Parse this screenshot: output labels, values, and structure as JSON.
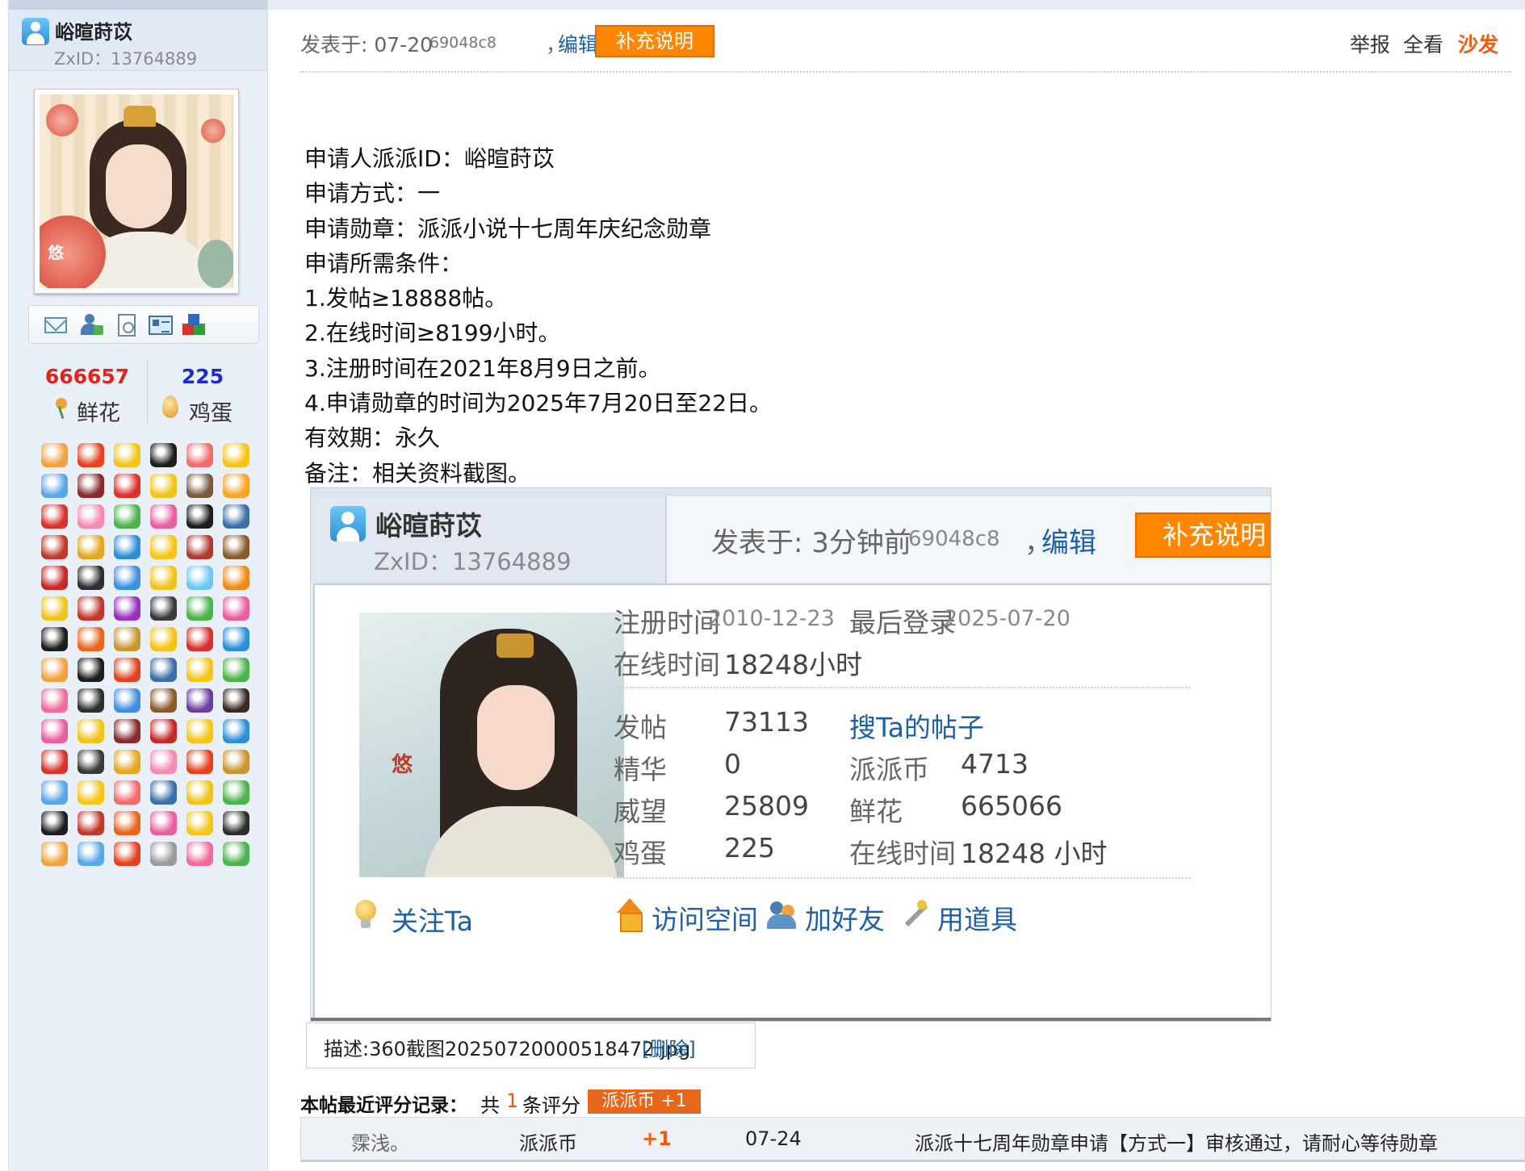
{
  "colors": {
    "accent_orange": "#ff8600",
    "link_blue": "#1d5fa8",
    "flower_red": "#e4211a",
    "egg_blue": "#1a2bd0",
    "sofa_orange": "#f05a12",
    "sidebar_bg": "#e9f0f8"
  },
  "sidebar": {
    "username": "峪暄莳苡",
    "zxid": "ZxID：13764889",
    "avatar_mark": "悠",
    "stats": {
      "flowers": "666657",
      "flowers_label": "鲜花",
      "eggs": "225",
      "eggs_label": "鸡蛋"
    },
    "medal_colors": [
      "#f2a23b",
      "#e4411f",
      "#f5c518",
      "#1d1d1d",
      "#f26b6b",
      "#f5c518",
      "#5aa7e8",
      "#8a2a2a",
      "#d9312b",
      "#f0c419",
      "#7a5a3a",
      "#f5a623",
      "#d9312b",
      "#f58bb3",
      "#4db34d",
      "#e85fa0",
      "#1d1d1d",
      "#3c6fa8",
      "#c0392b",
      "#e3a820",
      "#2d8fd6",
      "#f5c518",
      "#b03a2e",
      "#8a5a2b",
      "#c62828",
      "#2e2e2e",
      "#3d8fe0",
      "#f0c419",
      "#6ec6f5",
      "#f08a16",
      "#f0c419",
      "#c0392b",
      "#9b2fbf",
      "#3a3a3a",
      "#4db34d",
      "#e85fa0",
      "#1d1d1d",
      "#e8651c",
      "#c9952f",
      "#f5c518",
      "#d9312b",
      "#2d8fd6",
      "#f2a23b",
      "#1d1d1d",
      "#e4411f",
      "#3c6fa8",
      "#f5c518",
      "#4db34d",
      "#f26b9b",
      "#2e2e2e",
      "#3d8fe0",
      "#8a5a2b",
      "#6b3fa0",
      "#3a2a22",
      "#e85fa0",
      "#f0c419",
      "#8a2a2a",
      "#c62828",
      "#f5c518",
      "#2d8fd6",
      "#d9312b",
      "#3a3a3a",
      "#e3a820",
      "#f58bb3",
      "#e4411f",
      "#c9952f",
      "#5aa7e8",
      "#f5c518",
      "#f26b6b",
      "#3c6fa8",
      "#f0c419",
      "#4db34d",
      "#1d1d1d",
      "#c0392b",
      "#e8651c",
      "#e85fa0",
      "#f5c518",
      "#2e2e2e",
      "#f2a23b",
      "#5aa7e8",
      "#e4411f",
      "#9b9b9b",
      "#f26b9b",
      "#4db34d"
    ]
  },
  "post": {
    "posted_label": "发表于: 07-20",
    "hash": "69048c8",
    "comma": "，",
    "edit_label": "编辑",
    "supplement_label": "补充说明",
    "report_label": "举报",
    "view_all_label": "全看",
    "sofa_label": "沙发",
    "lines": [
      "申请人派派ID：峪暄莳苡",
      "申请方式：一",
      "申请勋章：派派小说十七周年庆纪念勋章",
      "申请所需条件：",
      "1.发帖≥18888帖。",
      "2.在线时间≥8199小时。",
      "3.注册时间在2021年8月9日之前。",
      "4.申请勋章的时间为2025年7月20日至22日。",
      "有效期：永久",
      "备注：相关资料截图。"
    ]
  },
  "screenshot": {
    "username": "峪暄莳苡",
    "zxid": "ZxID：13764889",
    "posted_label": "发表于: 3分钟前",
    "hash": "69048c8",
    "comma": "，",
    "edit_label": "编辑",
    "supplement_label": "补充说明",
    "avatar_mark": "悠",
    "follow_label": "关注Ta",
    "register_label": "注册时间",
    "register_value": "2010-12-23",
    "last_login_label": "最后登录",
    "last_login_value": "2025-07-20",
    "online_label": "在线时间",
    "online_value": "18248小时",
    "posts_label": "发帖",
    "posts_value": "73113",
    "search_posts_label": "搜Ta的帖子",
    "digest_label": "精华",
    "digest_value": "0",
    "coins_label": "派派币",
    "coins_value": "4713",
    "prestige_label": "威望",
    "prestige_value": "25809",
    "flowers_label": "鲜花",
    "flowers_value": "665066",
    "eggs_label": "鸡蛋",
    "eggs_value": "225",
    "online2_label": "在线时间",
    "online2_value": "18248 小时",
    "visit_space_label": "访问空间",
    "add_friend_label": "加好友",
    "use_item_label": "用道具"
  },
  "attachment": {
    "description": "描述:360截图20250720000518472.jpg",
    "delete_label": "[删除]"
  },
  "rating": {
    "title": "本帖最近评分记录：",
    "total_prefix": "共",
    "count": "1",
    "unit": "条评分",
    "tag": "派派币 +1",
    "row": {
      "user": "霂浅。",
      "currency": "派派币",
      "score": "+1",
      "date": "07-24",
      "reason": "派派十七周年勋章申请【方式一】审核通过，请耐心等待勋章"
    }
  }
}
